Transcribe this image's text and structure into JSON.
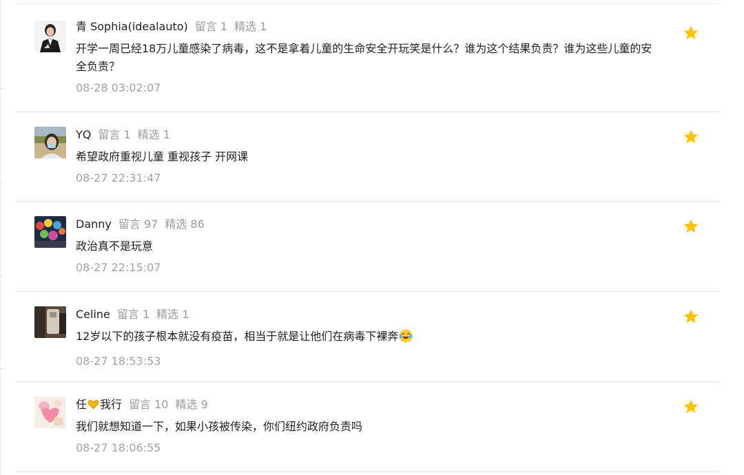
{
  "comments": [
    {
      "nickname": "青 Sophia(idealauto)",
      "replies": "留言 1",
      "featured": "精选 1",
      "content": "开学一周已经18万儿童感染了病毒，这不是拿着儿童的生命安全开玩笑是什么？谁为这个结果负责？谁为这些儿童的安全负责？",
      "time": "08-28 03:02:07",
      "starred": true
    },
    {
      "nickname": "YQ",
      "replies": "留言 1",
      "featured": "精选 1",
      "content": "希望政府重视儿童 重视孩子 开网课",
      "time": "08-27 22:31:47",
      "starred": true
    },
    {
      "nickname": "Danny",
      "replies": "留言 97",
      "featured": "精选 86",
      "content": "政治真不是玩意",
      "time": "08-27 22:15:07",
      "starred": true
    },
    {
      "nickname": "Celine",
      "replies": "留言 1",
      "featured": "精选 1",
      "content": "12岁以下的孩子根本就没有疫苗，相当于就是让他们在病毒下裸奔",
      "time": "08-27 18:53:53",
      "starred": true,
      "trailing_emoji": "laughing-tears-emoji"
    },
    {
      "nickname_a": "任",
      "nickname_b": "我行",
      "nickname_heart": "yellow-heart-icon",
      "replies": "留言 10",
      "featured": "精选 9",
      "content": "我们就想知道一下，如果小孩被传染，你们纽约政府负责吗",
      "time": "08-27 18:06:55",
      "starred": true
    }
  ],
  "colors": {
    "star": "#FFC300",
    "nickname": "#222222",
    "meta": "#9A9A9A",
    "content": "#1F1F1F",
    "time": "#A3A3A3",
    "divider": "#E5E5E5"
  }
}
